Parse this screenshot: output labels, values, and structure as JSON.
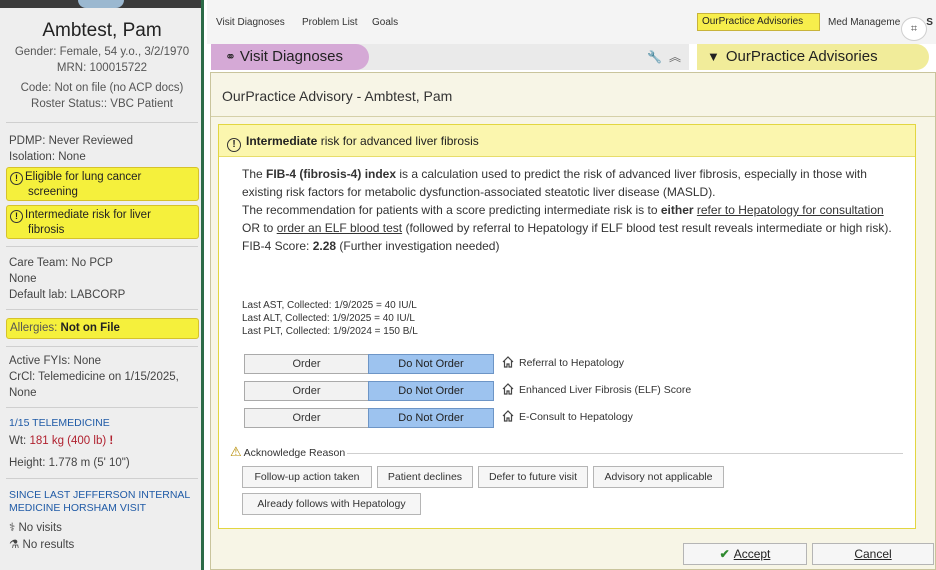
{
  "patient": {
    "name": "Ambtest, Pam",
    "gender_line": "Gender: Female, 54 y.o., 3/2/1970",
    "mrn_line": "MRN: 100015722",
    "code_line": "Code: Not on file (no ACP docs)",
    "roster_line": "Roster Status:: VBC Patient"
  },
  "sidebar": {
    "pdmp": "PDMP: Never Reviewed",
    "isolation": "Isolation: None",
    "alerts": [
      {
        "icon": "!",
        "line1": "Eligible for lung cancer",
        "line2": "screening"
      },
      {
        "icon": "!",
        "line1": "Intermediate risk for liver",
        "line2": "fibrosis"
      }
    ],
    "care_team": "Care Team: No PCP",
    "care_team_none": "None",
    "default_lab": "Default lab: LABCORP",
    "allergies_prefix": "Allergies:",
    "allergies_value": "Not on File",
    "active_fyis": "Active FYIs: None",
    "crcl_line1": "CrCl: Telemedicine on 1/15/2025,",
    "crcl_line2": "None",
    "encounter_head": "1/15 TELEMEDICINE",
    "wt_label": "Wt:",
    "wt_value": "181 kg (400 lb)",
    "wt_flag": "!",
    "height": "Height:  1.778 m (5' 10\")",
    "since_line1": "SINCE LAST JEFFERSON INTERNAL",
    "since_line2": "MEDICINE HORSHAM VISIT",
    "no_visits": "No visits",
    "no_results": "No results"
  },
  "topnav": {
    "links": [
      "Visit Diagnoses",
      "Problem List",
      "Goals"
    ],
    "active_tab": "OurPractice Advisories",
    "med_tab": "Med Manageme",
    "med_tab_trail": "S",
    "vd_header": "Visit Diagnoses",
    "opa_header": "OurPractice Advisories"
  },
  "modal": {
    "title": "OurPractice Advisory - Ambtest, Pam",
    "advisory_bold": "Intermediate",
    "advisory_rest": " risk for advanced liver fibrosis",
    "para1_pre": "The ",
    "para1_bold": "FIB-4 (fibrosis-4) index",
    "para1_post": " is a calculation used to predict the risk of advanced liver fibrosis, especially in those with existing risk factors for metabolic dysfunction-associated steatotic liver disease (MASLD).",
    "para2_pre": "The recommendation for patients with a score predicting intermediate risk is to ",
    "para2_either": "either",
    "para2_link1": "refer to Hepatology for consultation",
    "para2_or": " OR ",
    "para2_to": "to ",
    "para2_link2": "order an ELF blood test",
    "para2_post": " (followed by referral to Hepatology if ELF blood test result reveals intermediate or high risk).",
    "score_label": "FIB-4 Score: ",
    "score_value": "2.28",
    "score_note": " (Further investigation needed)",
    "labs": [
      "Last AST, Collected: 1/9/2025 = 40 IU/L",
      "Last ALT, Collected: 1/9/2025 = 40 IU/L",
      "Last PLT, Collected: 1/9/2024 = 150 B/L"
    ],
    "orders": [
      {
        "order": "Order",
        "no_order": "Do Not Order",
        "label": "Referral to Hepatology"
      },
      {
        "order": "Order",
        "no_order": "Do Not Order",
        "label": "Enhanced Liver Fibrosis (ELF) Score"
      },
      {
        "order": "Order",
        "no_order": "Do Not Order",
        "label": "E-Consult to Hepatology"
      }
    ],
    "ack_label": "Acknowledge Reason",
    "ack_reasons": [
      "Follow-up action taken",
      "Patient declines",
      "Defer to future visit",
      "Advisory not applicable",
      "Already follows with Hepatology"
    ],
    "accept": "Accept",
    "cancel": "Cancel"
  },
  "colors": {
    "sidebar_bg": "#eeeeee",
    "alert_yellow": "#f5f03c",
    "no_order_blue": "#9dc3ef",
    "visit_dx_pill": "#d5a9d6",
    "sidebar_border": "#2c6b47"
  },
  "icons": [
    "alert-circle-icon",
    "wrench-icon",
    "collapse-icon",
    "filter-icon",
    "home-icon",
    "warning-icon",
    "check-icon",
    "screenshot-icon",
    "stethoscope-icon",
    "flask-icon"
  ]
}
